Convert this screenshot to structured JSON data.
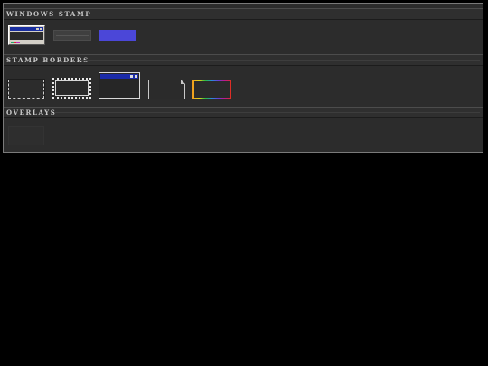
{
  "sections": [
    {
      "title": "WINDOWS STAMP"
    },
    {
      "title": "STAMP BORDERS"
    },
    {
      "title": "OVERLAYS"
    }
  ],
  "windows_stamp": {
    "items": [
      "windows-stamp-preview",
      "gray-stamp-swatch",
      "blue-stamp-swatch"
    ],
    "colors": {
      "titlebar": "#1a2fa0",
      "gray": "#3f3f3f",
      "blue": "#4b47d8"
    }
  },
  "stamp_borders": {
    "items": [
      "dotted-border",
      "scalloped-border",
      "window-border",
      "folded-page-border",
      "rainbow-border"
    ],
    "colors": {
      "rainbow": [
        "#f29b1e",
        "#e4d21f",
        "#2bbd3f",
        "#2a8be0",
        "#6b3ed6",
        "#c2188a",
        "#e0301e"
      ]
    }
  },
  "overlays": {
    "items": [
      "overlay-option"
    ]
  },
  "theme": {
    "background": "#000000",
    "panel": "#2c2c2c",
    "header_text": "#c9c9c9"
  }
}
